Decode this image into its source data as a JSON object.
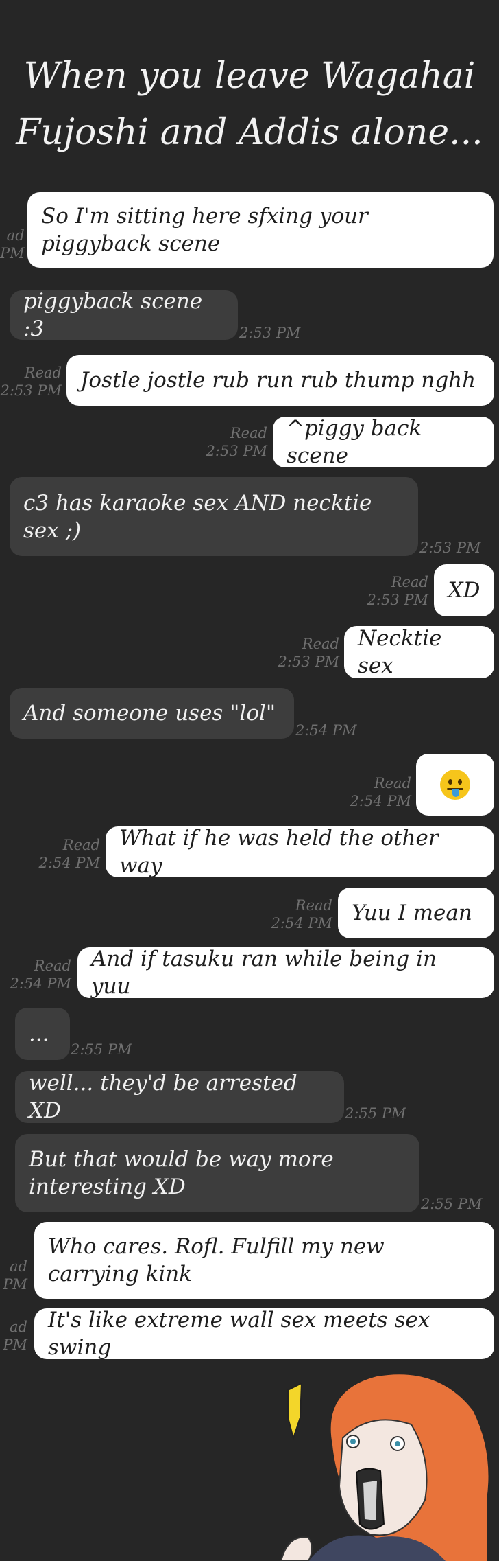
{
  "title": {
    "line1": "When you leave Wagahai",
    "line2": "Fujoshi and Addis alone..."
  },
  "messages": [
    {
      "text": "So I'm sitting here sfxing your piggyback scene",
      "read": "ad",
      "time": "PM"
    },
    {
      "text": "piggyback scene :3",
      "time": "2:53 PM"
    },
    {
      "text": "Jostle jostle rub run rub thump nghh",
      "read": "Read",
      "time": "2:53 PM"
    },
    {
      "text": "^piggy back scene",
      "read": "Read",
      "time": "2:53 PM"
    },
    {
      "text": "c3 has karaoke sex AND necktie sex ;)",
      "time": "2:53 PM"
    },
    {
      "text": "XD",
      "read": "Read",
      "time": "2:53 PM"
    },
    {
      "text": "Necktie sex",
      "read": "Read",
      "time": "2:53 PM"
    },
    {
      "text": "And someone uses \"lol\"",
      "time": "2:54 PM"
    },
    {
      "emoji": "drooling-face",
      "read": "Read",
      "time": "2:54 PM"
    },
    {
      "text": "What if he was held the other way",
      "read": "Read",
      "time": "2:54 PM"
    },
    {
      "text": "Yuu I mean",
      "read": "Read",
      "time": "2:54 PM"
    },
    {
      "text": "And if tasuku ran while being in yuu",
      "read": "Read",
      "time": "2:54 PM"
    },
    {
      "text": "...",
      "time": "2:55 PM"
    },
    {
      "text": "well... they'd be arrested XD",
      "time": "2:55 PM"
    },
    {
      "text": "But that would be way more interesting XD",
      "time": "2:55 PM"
    },
    {
      "text": "Who cares. Rofl. Fulfill my new carrying kink",
      "read": "ad",
      "time": "PM"
    },
    {
      "text": "It's like extreme wall sex meets sex swing",
      "read": "ad",
      "time": "PM"
    }
  ],
  "colors": {
    "background": "#262626",
    "outgoing_bubble": "#ffffff",
    "incoming_bubble": "#3d3d3d",
    "meta_text": "#6f6f6f",
    "character_hair": "#e8733a",
    "exclamation_mark": "#f3d62a"
  }
}
